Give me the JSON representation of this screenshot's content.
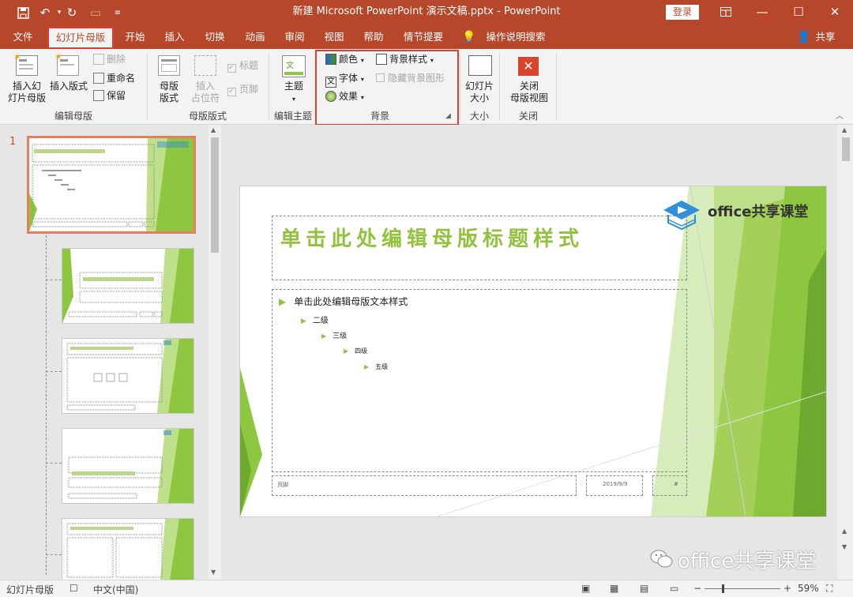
{
  "window": {
    "title": "新建 Microsoft PowerPoint 演示文稿.pptx  -  PowerPoint",
    "login_label": "登录"
  },
  "tabs": [
    {
      "label": "文件"
    },
    {
      "label": "幻灯片母版",
      "active": true
    },
    {
      "label": "开始"
    },
    {
      "label": "插入"
    },
    {
      "label": "切换"
    },
    {
      "label": "动画"
    },
    {
      "label": "审阅"
    },
    {
      "label": "视图"
    },
    {
      "label": "帮助"
    },
    {
      "label": "情节提要"
    }
  ],
  "tell_me": "操作说明搜索",
  "share_label": "共享",
  "ribbon": {
    "edit_master": {
      "insert_slide_master": "插入幻\n灯片母版",
      "insert_layout": "插入版式",
      "delete": "删除",
      "rename": "重命名",
      "preserve": "保留",
      "label": "编辑母版"
    },
    "master_layout": {
      "master_layout_btn": "母版\n版式",
      "insert_placeholder": "插入\n占位符",
      "title_check": "标题",
      "footer_check": "页脚",
      "label": "母版版式"
    },
    "edit_theme": {
      "themes": "主题",
      "label": "编辑主题"
    },
    "background": {
      "colors": "颜色",
      "fonts": "字体",
      "effects": "效果",
      "background_styles": "背景样式",
      "hide_background": "隐藏背景图形",
      "label": "背景"
    },
    "size": {
      "slide_size": "幻灯片\n大小",
      "label": "大小"
    },
    "close": {
      "close_master": "关闭\n母版视图",
      "label": "关闭"
    }
  },
  "thumbnails": {
    "first_number": "1"
  },
  "slide": {
    "logo_text": "office共享课堂",
    "title_placeholder": "单击此处编辑母版标题样式",
    "body_levels": [
      "单击此处编辑母版文本样式",
      "二级",
      "三级",
      "四级",
      "五级"
    ],
    "footer_text": "页脚",
    "date_text": "2019/9/9",
    "number_text": "#"
  },
  "status": {
    "view_name": "幻灯片母版",
    "language": "中文(中国)",
    "zoom": "59%"
  },
  "watermark_text": "office共享课堂",
  "colors": {
    "brand": "#b7472a",
    "highlight": "#e03c31",
    "accent_green": "#8dc63f",
    "title_green": "#92c13e"
  }
}
